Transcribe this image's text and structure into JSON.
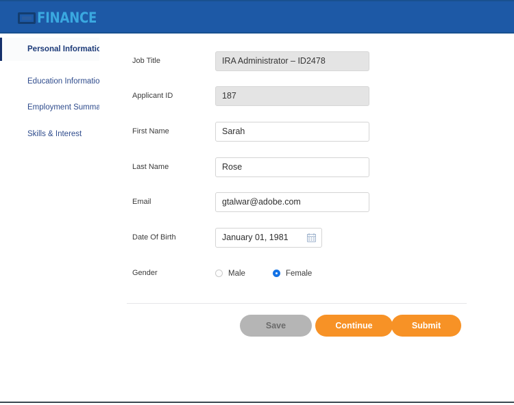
{
  "header": {
    "brand_mark_icon": "square-logo-mark-icon",
    "brand_text": "FINANCE",
    "background_color": "#1d59a6",
    "brand_color": "#3aa8e0"
  },
  "sidebar": {
    "items": [
      {
        "label": "Personal Information",
        "active": true
      },
      {
        "label": "Education Information",
        "active": false
      },
      {
        "label": "Employment Summary",
        "active": false
      },
      {
        "label": "Skills & Interest",
        "active": false
      }
    ],
    "active_indicator_color": "#15306b",
    "link_color": "#2e4b8c"
  },
  "form": {
    "fields": [
      {
        "label": "Job Title",
        "value": "IRA Administrator – ID2478",
        "placeholder": "Job Title",
        "disabled": true
      },
      {
        "label": "Applicant ID",
        "value": "187",
        "placeholder": "Applicant ID",
        "disabled": true
      },
      {
        "label": "First Name",
        "value": "Sarah",
        "placeholder": "First Name",
        "disabled": false
      },
      {
        "label": "Last Name",
        "value": "Rose",
        "placeholder": "Last Name",
        "disabled": false
      },
      {
        "label": "Email",
        "value": "gtalwar@adobe.com",
        "placeholder": "Email",
        "disabled": false
      },
      {
        "label": "Date Of Birth",
        "value": "January 01, 1981",
        "placeholder": "Date Of Birth",
        "disabled": false
      }
    ],
    "date_picker_icon": "calendar-icon",
    "gender": {
      "label": "Gender",
      "options": [
        {
          "label": "Male",
          "selected": false
        },
        {
          "label": "Female",
          "selected": true
        }
      ],
      "selected_color": "#1473e6"
    }
  },
  "actions": {
    "save_label": "Save",
    "continue_label": "Continue",
    "submit_label": "Submit",
    "primary_color": "#f79226",
    "disabled_color": "#b5b5b5"
  }
}
